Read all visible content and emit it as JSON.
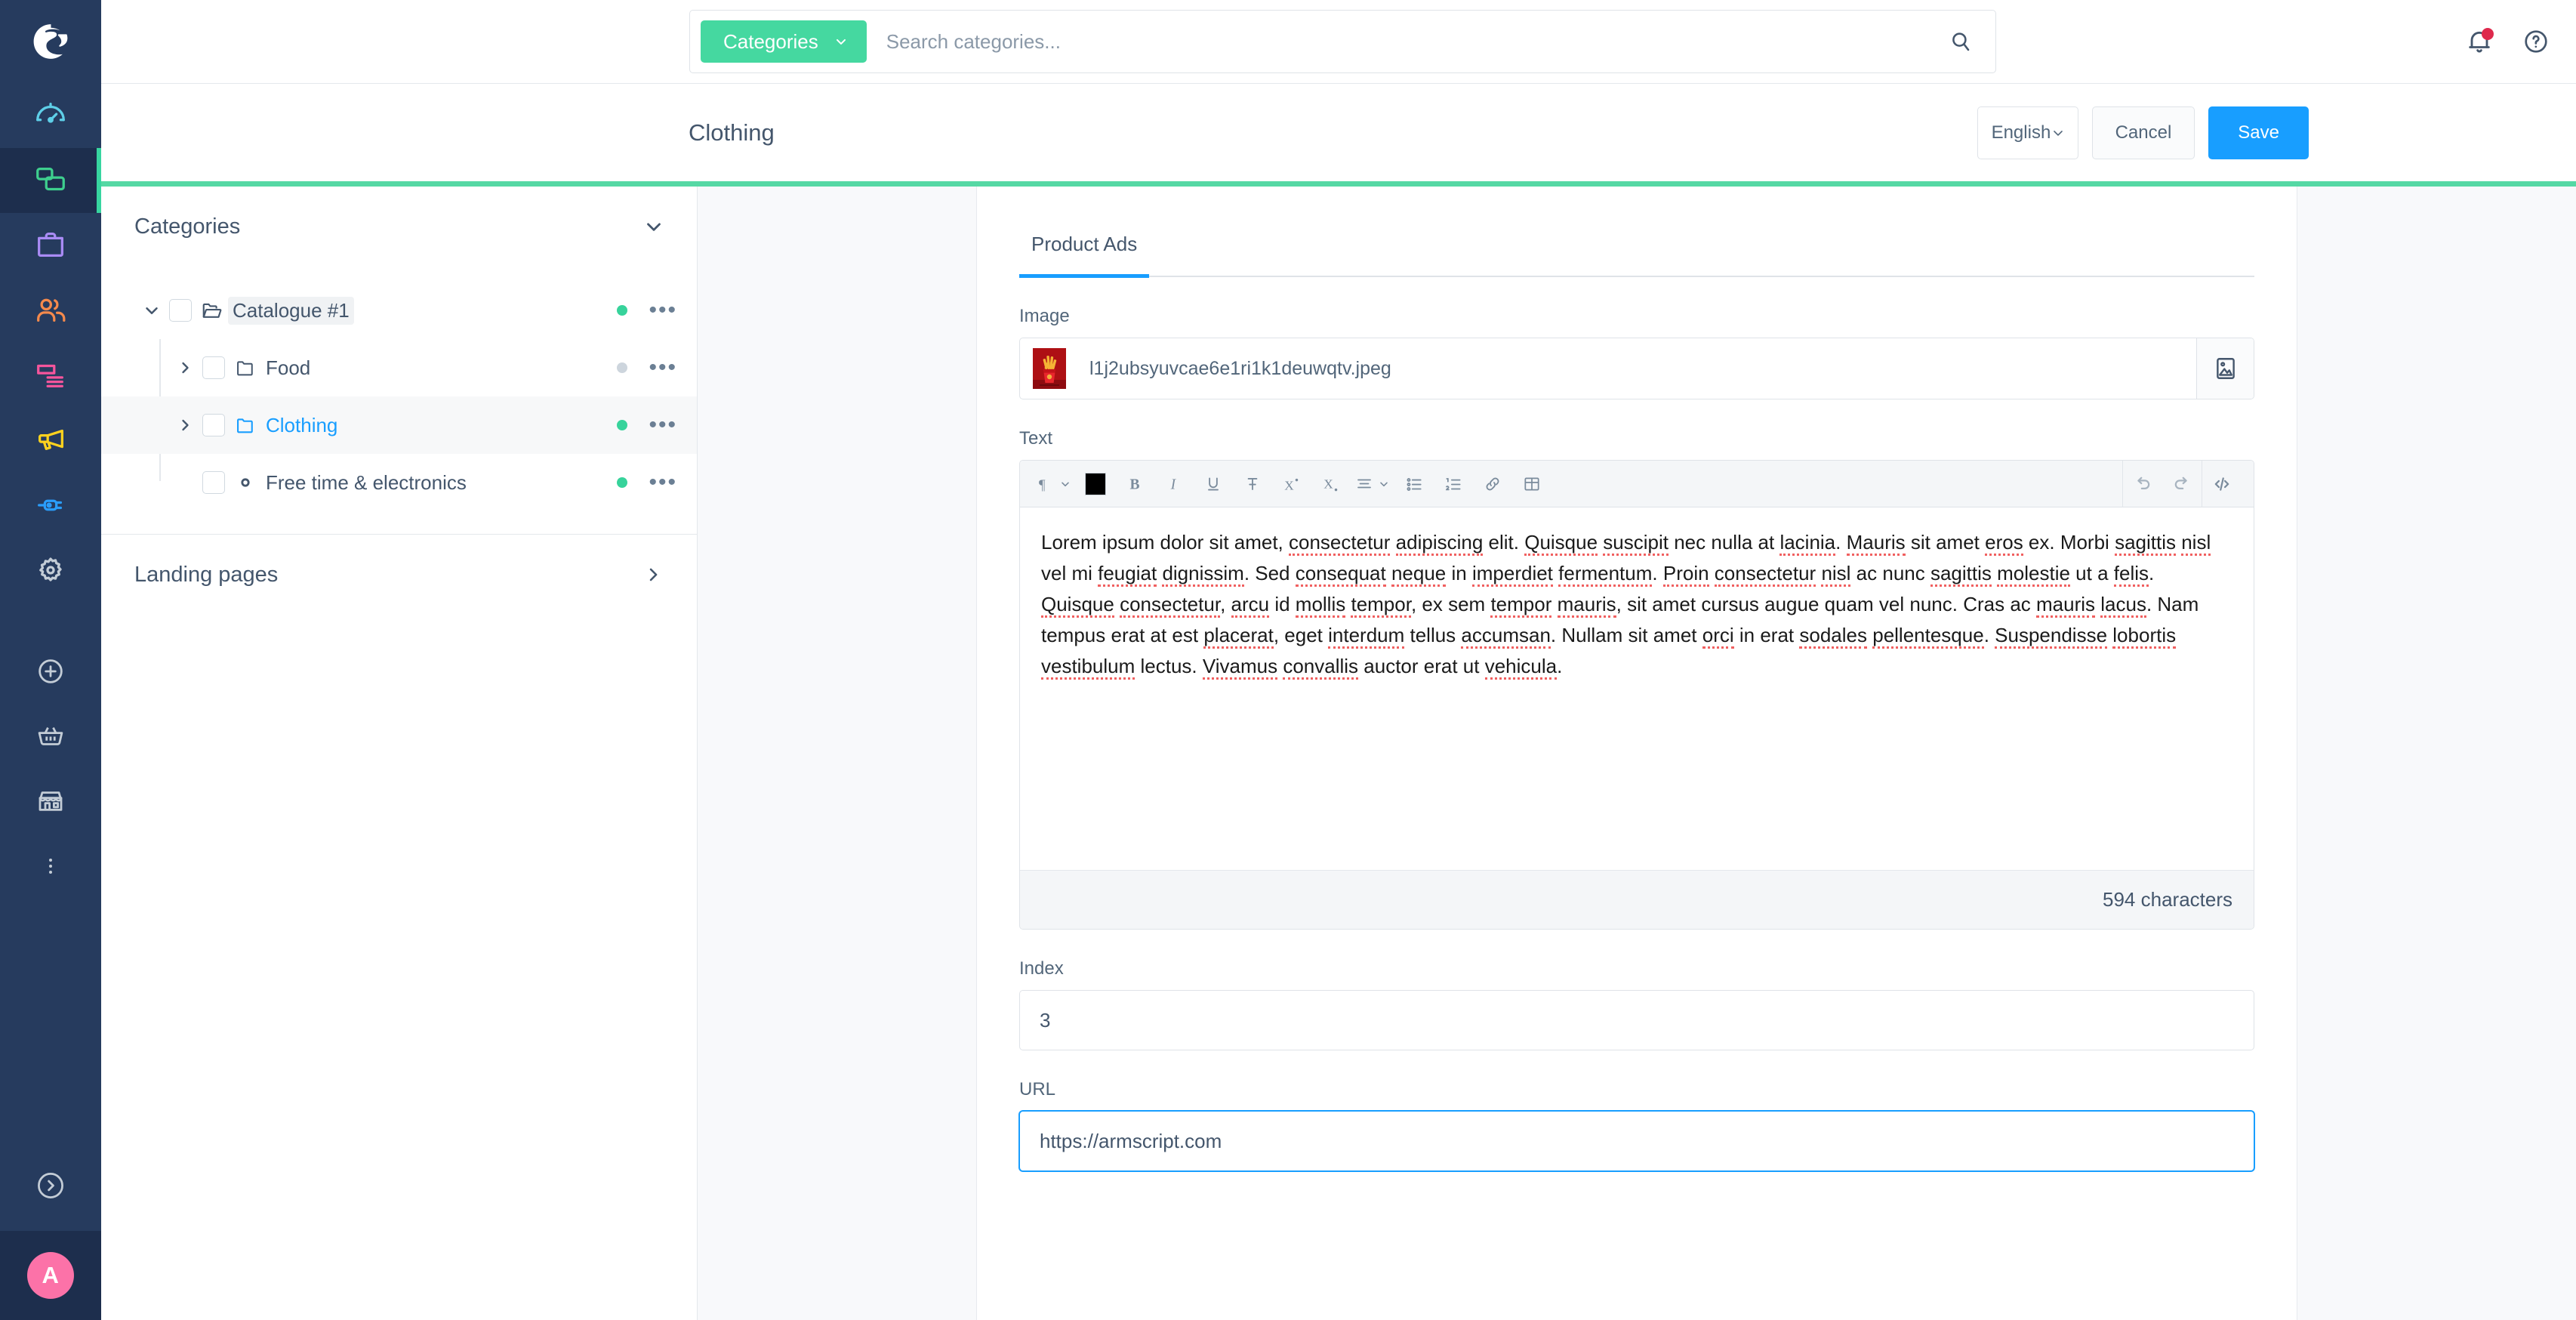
{
  "rail": {
    "logo_name": "shopware-logo",
    "items": [
      {
        "name": "dashboard",
        "icon": "gauge-icon",
        "color": "#5ecfe8",
        "active": false
      },
      {
        "name": "catalogues",
        "icon": "layers-icon",
        "color": "#3ecf8e",
        "active": true
      },
      {
        "name": "orders",
        "icon": "bag-icon",
        "color": "#a98bf5",
        "active": false
      },
      {
        "name": "customers",
        "icon": "users-icon",
        "color": "#f58a4c",
        "active": false
      },
      {
        "name": "content",
        "icon": "content-icon",
        "color": "#f5559c",
        "active": false
      },
      {
        "name": "marketing",
        "icon": "megaphone-icon",
        "color": "#ffd21e",
        "active": false
      },
      {
        "name": "extensions",
        "icon": "plug-icon",
        "color": "#2a9dfb",
        "active": false
      },
      {
        "name": "settings",
        "icon": "gear-icon",
        "color": "#c3ccd6",
        "active": false
      }
    ],
    "bottom_items": [
      {
        "name": "add",
        "icon": "plus-circle-icon"
      },
      {
        "name": "basket",
        "icon": "basket-icon"
      },
      {
        "name": "store",
        "icon": "store-icon"
      },
      {
        "name": "more",
        "icon": "dots-vertical-icon"
      }
    ],
    "expand_icon": "chevron-right-circle-icon",
    "user_initial": "A"
  },
  "topbar": {
    "category_button_label": "Categories",
    "category_caret_icon": "chevron-down-icon",
    "search_value": "",
    "search_placeholder": "Search categories...",
    "search_icon": "search-icon",
    "notifications_icon": "bell-icon",
    "notifications_has_badge": true,
    "help_icon": "question-circle-icon"
  },
  "pagehead": {
    "title": "Clothing",
    "language": "English",
    "language_caret_icon": "chevron-down-icon",
    "cancel_label": "Cancel",
    "save_label": "Save"
  },
  "categories_panel": {
    "header_title": "Categories",
    "header_caret_icon": "chevron-down-icon",
    "tree": [
      {
        "name": "catalogue-1",
        "label": "Catalogue #1",
        "level": 0,
        "caret": "chevron-down-icon",
        "folder_icon": "folder-open-icon",
        "status": "on",
        "selected": false,
        "highlighted": true,
        "active_text": false,
        "menu_icon": "ellipsis-icon"
      },
      {
        "name": "food",
        "label": "Food",
        "level": 1,
        "caret": "chevron-right-icon",
        "folder_icon": "folder-icon",
        "status": "off",
        "selected": false,
        "highlighted": false,
        "active_text": false,
        "menu_icon": "ellipsis-icon"
      },
      {
        "name": "clothing",
        "label": "Clothing",
        "level": 1,
        "caret": "chevron-right-icon",
        "folder_icon": "folder-icon",
        "status": "on",
        "selected": true,
        "highlighted": false,
        "active_text": true,
        "menu_icon": "ellipsis-icon"
      },
      {
        "name": "free-time-electronics",
        "label": "Free time & electronics",
        "level": 1,
        "caret": "none",
        "folder_icon": "circle-dot-icon",
        "status": "on",
        "selected": false,
        "highlighted": false,
        "active_text": false,
        "menu_icon": "ellipsis-icon"
      }
    ],
    "landing_title": "Landing pages",
    "landing_caret_icon": "chevron-right-icon"
  },
  "detail": {
    "tabs": [
      {
        "label": "Product Ads",
        "active": true
      }
    ],
    "image": {
      "label": "Image",
      "filename": "l1j2ubsyuvcae6e1ri1k1deuwqtv.jpeg",
      "thumbnail_name": "product-thumbnail",
      "picker_icon": "image-icon"
    },
    "text": {
      "label": "Text",
      "toolbar": [
        {
          "name": "paragraph-format-dropdown",
          "icon": "paragraph-icon",
          "caret": true
        },
        {
          "name": "text-color-swatch",
          "icon": "color-swatch-icon",
          "color": "#000000"
        },
        {
          "name": "bold-button",
          "icon": "bold-icon"
        },
        {
          "name": "italic-button",
          "icon": "italic-icon"
        },
        {
          "name": "underline-button",
          "icon": "underline-icon"
        },
        {
          "name": "strikethrough-button",
          "icon": "strikethrough-icon"
        },
        {
          "name": "superscript-button",
          "icon": "superscript-icon"
        },
        {
          "name": "subscript-button",
          "icon": "subscript-icon"
        },
        {
          "name": "align-dropdown",
          "icon": "align-icon",
          "caret": true
        },
        {
          "name": "bullet-list-button",
          "icon": "bullet-list-icon"
        },
        {
          "name": "numbered-list-button",
          "icon": "numbered-list-icon"
        },
        {
          "name": "link-button",
          "icon": "link-icon"
        },
        {
          "name": "table-button",
          "icon": "table-icon"
        }
      ],
      "toolbar_right": [
        {
          "name": "undo-button",
          "icon": "undo-icon"
        },
        {
          "name": "redo-button",
          "icon": "redo-icon"
        },
        {
          "name": "code-view-button",
          "icon": "code-icon"
        }
      ],
      "content": "Lorem ipsum dolor sit amet, consectetur adipiscing elit. Quisque suscipit nec nulla at lacinia. Mauris sit amet eros ex. Morbi sagittis nisl vel mi feugiat dignissim. Sed consequat neque in imperdiet fermentum. Proin consectetur nisl ac nunc sagittis molestie ut a felis. Quisque consectetur, arcu id mollis tempor, ex sem tempor mauris, sit amet cursus augue quam vel nunc. Cras ac mauris lacus. Nam tempus erat at est placerat, eget interdum tellus accumsan. Nullam sit amet orci in erat sodales pellentesque. Suspendisse lobortis vestibulum lectus. Vivamus convallis auctor erat ut vehicula.",
      "char_count": "594 characters"
    },
    "index": {
      "label": "Index",
      "value": "3"
    },
    "url": {
      "label": "URL",
      "value": "https://armscript.com",
      "focused": true
    }
  },
  "colors": {
    "rail_bg": "#263b5e",
    "accent_green": "#55d8a4",
    "primary_blue": "#189eff",
    "avatar_pink": "#fc72a8",
    "badge_red": "#de294c"
  }
}
